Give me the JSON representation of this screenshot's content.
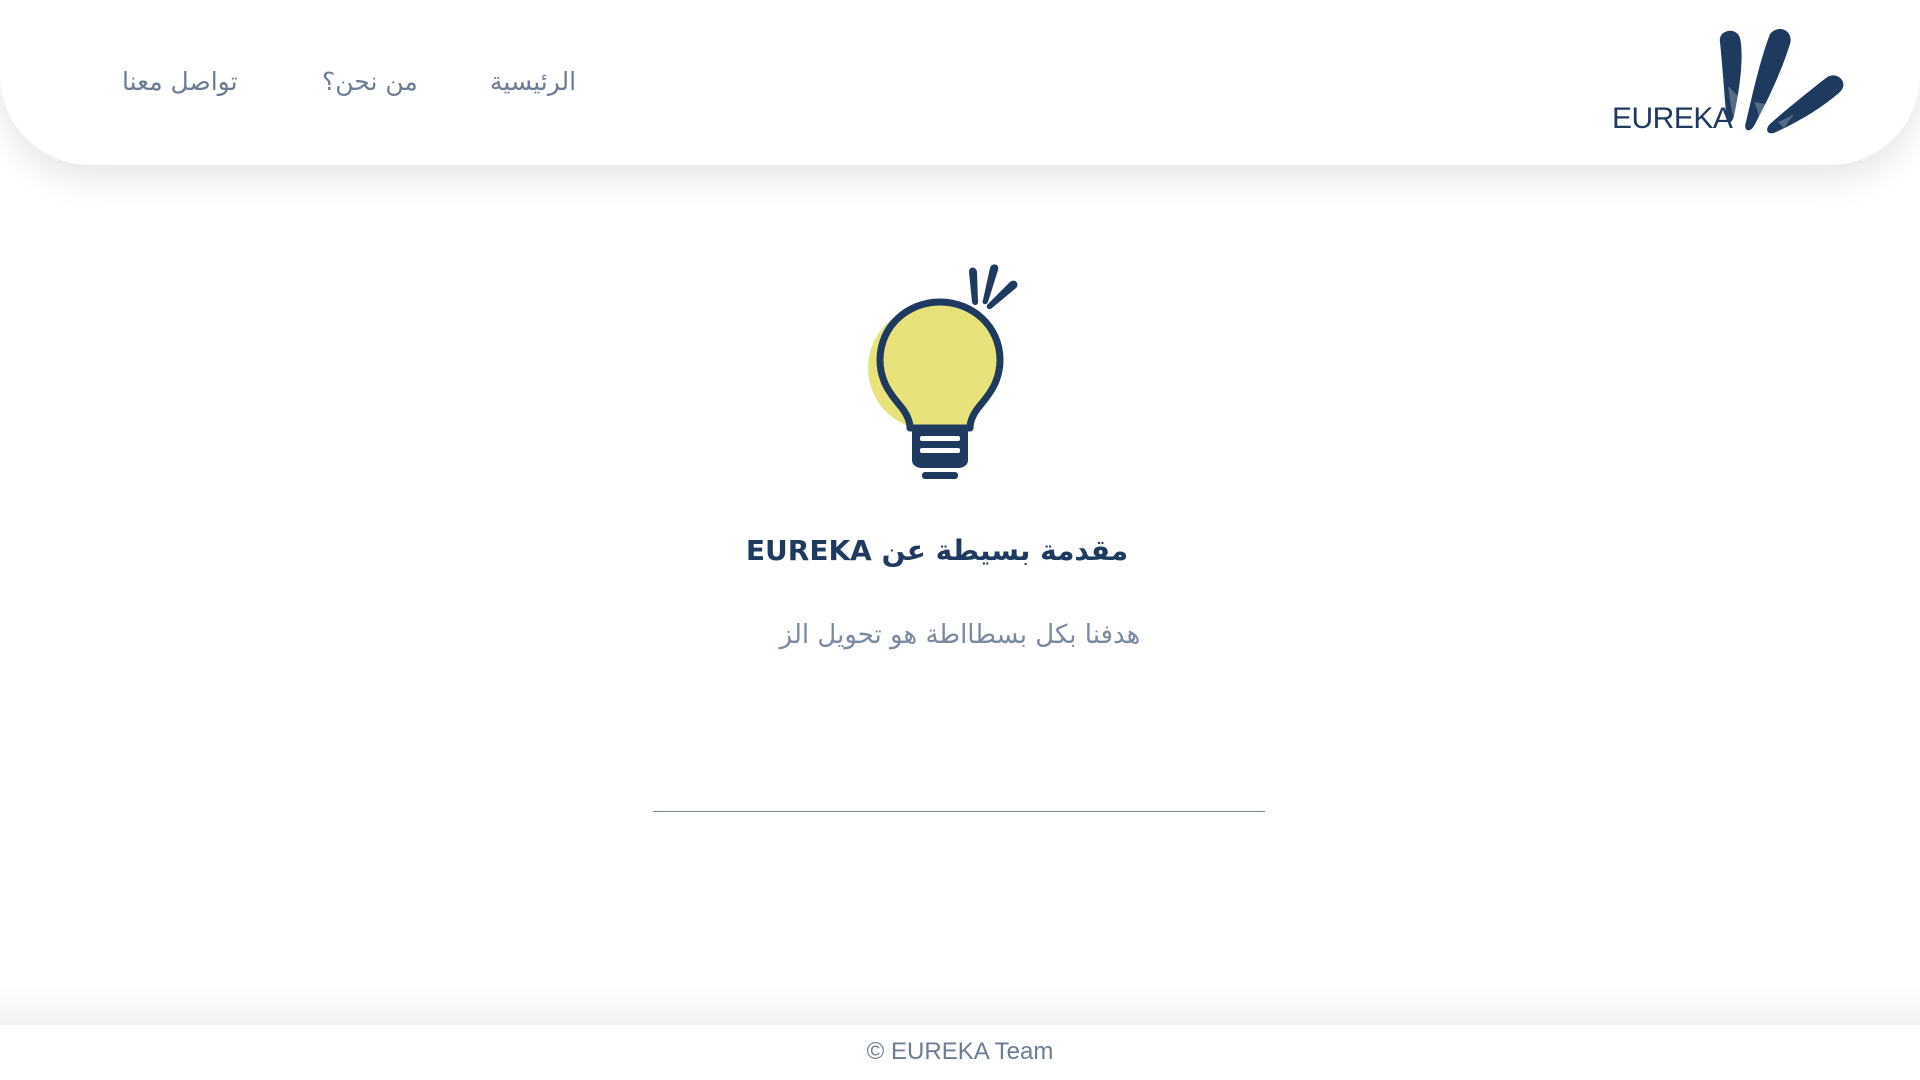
{
  "header": {
    "logo_text": "EUREKA",
    "nav": {
      "home": "الرئيسية",
      "about": "من نحن؟",
      "contact": "تواصل معنا"
    }
  },
  "main": {
    "title": "مقدمة بسيطة عن EUREKA",
    "subtitle": "هدفنا بكل بسطااطة هو تحويل الز",
    "illustration_icon": "lightbulb-icon"
  },
  "footer": {
    "copyright": "© EUREKA Team"
  },
  "colors": {
    "brand_navy": "#1e3a5f",
    "nav_text": "#6b7d93",
    "bulb_yellow": "#e8e27a"
  }
}
